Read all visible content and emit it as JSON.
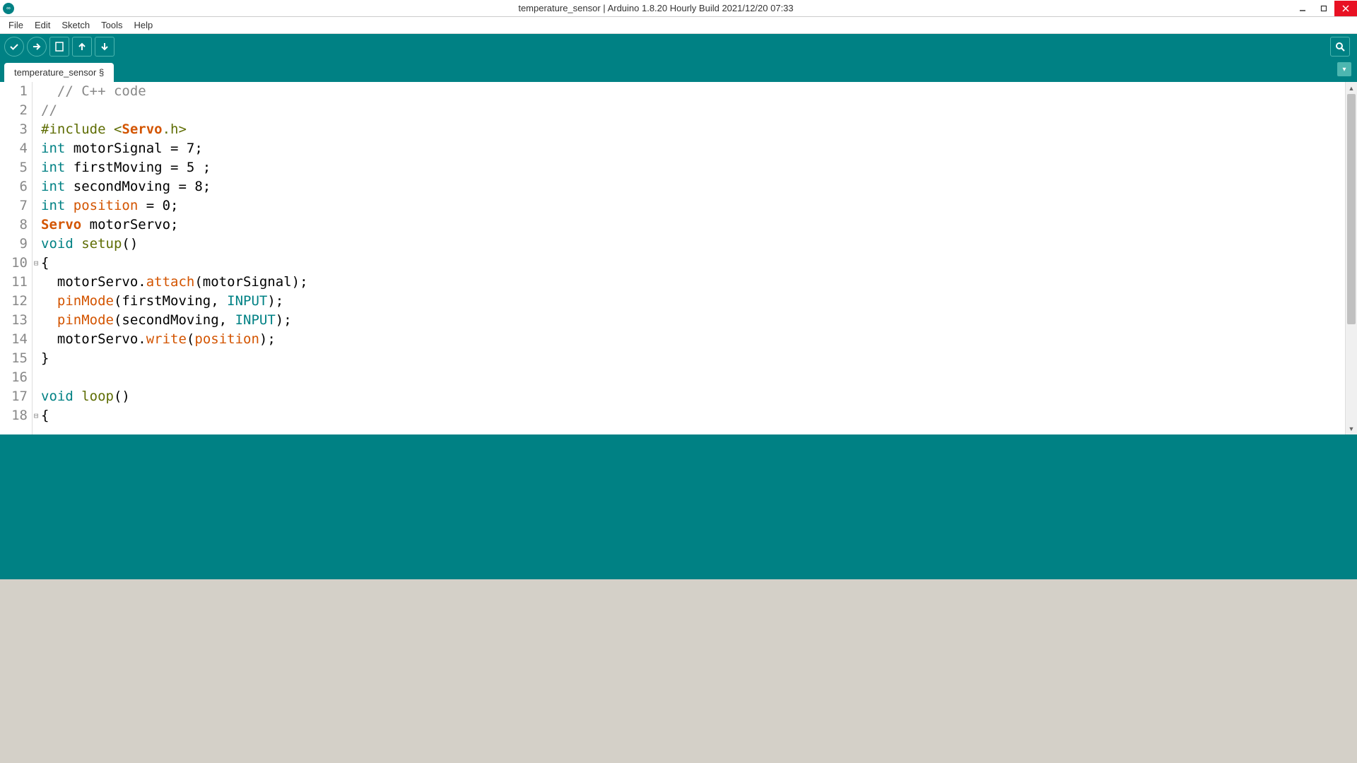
{
  "window": {
    "title": "temperature_sensor | Arduino 1.8.20 Hourly Build 2021/12/20 07:33"
  },
  "menu": {
    "file": "File",
    "edit": "Edit",
    "sketch": "Sketch",
    "tools": "Tools",
    "help": "Help"
  },
  "toolbar_icons": {
    "verify": "verify-icon",
    "upload": "upload-icon",
    "new": "new-icon",
    "open": "open-icon",
    "save": "save-icon",
    "serial": "serial-monitor-icon"
  },
  "tab": {
    "name": "temperature_sensor §"
  },
  "code": {
    "lines": [
      {
        "n": "1",
        "fold": "",
        "tokens": [
          {
            "c": "tk-comment",
            "t": "  // C++ code"
          }
        ]
      },
      {
        "n": "2",
        "fold": "",
        "tokens": [
          {
            "c": "tk-comment",
            "t": "//"
          }
        ]
      },
      {
        "n": "3",
        "fold": "",
        "tokens": [
          {
            "c": "tk-preproc",
            "t": "#include <"
          },
          {
            "c": "tk-keyword",
            "t": "Servo"
          },
          {
            "c": "tk-preproc",
            "t": ".h>"
          }
        ]
      },
      {
        "n": "4",
        "fold": "",
        "tokens": [
          {
            "c": "tk-type",
            "t": "int"
          },
          {
            "c": "",
            "t": " motorSignal = 7;"
          }
        ]
      },
      {
        "n": "5",
        "fold": "",
        "tokens": [
          {
            "c": "tk-type",
            "t": "int"
          },
          {
            "c": "",
            "t": " firstMoving = 5 ;"
          }
        ]
      },
      {
        "n": "6",
        "fold": "",
        "tokens": [
          {
            "c": "tk-type",
            "t": "int"
          },
          {
            "c": "",
            "t": " secondMoving = 8;"
          }
        ]
      },
      {
        "n": "7",
        "fold": "",
        "tokens": [
          {
            "c": "tk-type",
            "t": "int"
          },
          {
            "c": "",
            "t": " "
          },
          {
            "c": "tk-var",
            "t": "position"
          },
          {
            "c": "",
            "t": " = 0;"
          }
        ]
      },
      {
        "n": "8",
        "fold": "",
        "tokens": [
          {
            "c": "tk-keyword",
            "t": "Servo"
          },
          {
            "c": "",
            "t": " motorServo;"
          }
        ]
      },
      {
        "n": "9",
        "fold": "",
        "tokens": [
          {
            "c": "tk-type",
            "t": "void"
          },
          {
            "c": "",
            "t": " "
          },
          {
            "c": "tk-preproc",
            "t": "setup"
          },
          {
            "c": "",
            "t": "()"
          }
        ]
      },
      {
        "n": "10",
        "fold": "⊟",
        "tokens": [
          {
            "c": "",
            "t": "{"
          }
        ]
      },
      {
        "n": "11",
        "fold": "",
        "tokens": [
          {
            "c": "",
            "t": "  motorServo."
          },
          {
            "c": "tk-func",
            "t": "attach"
          },
          {
            "c": "",
            "t": "(motorSignal);"
          }
        ]
      },
      {
        "n": "12",
        "fold": "",
        "tokens": [
          {
            "c": "",
            "t": "  "
          },
          {
            "c": "tk-func",
            "t": "pinMode"
          },
          {
            "c": "",
            "t": "(firstMoving, "
          },
          {
            "c": "tk-const",
            "t": "INPUT"
          },
          {
            "c": "",
            "t": ");"
          }
        ]
      },
      {
        "n": "13",
        "fold": "",
        "tokens": [
          {
            "c": "",
            "t": "  "
          },
          {
            "c": "tk-func",
            "t": "pinMode"
          },
          {
            "c": "",
            "t": "(secondMoving, "
          },
          {
            "c": "tk-const",
            "t": "INPUT"
          },
          {
            "c": "",
            "t": ");"
          }
        ]
      },
      {
        "n": "14",
        "fold": "",
        "tokens": [
          {
            "c": "",
            "t": "  motorServo."
          },
          {
            "c": "tk-func",
            "t": "write"
          },
          {
            "c": "",
            "t": "("
          },
          {
            "c": "tk-var",
            "t": "position"
          },
          {
            "c": "",
            "t": ");"
          }
        ]
      },
      {
        "n": "15",
        "fold": "",
        "tokens": [
          {
            "c": "",
            "t": "}"
          }
        ]
      },
      {
        "n": "16",
        "fold": "",
        "tokens": [
          {
            "c": "",
            "t": ""
          }
        ]
      },
      {
        "n": "17",
        "fold": "",
        "tokens": [
          {
            "c": "tk-type",
            "t": "void"
          },
          {
            "c": "",
            "t": " "
          },
          {
            "c": "tk-preproc",
            "t": "loop"
          },
          {
            "c": "",
            "t": "()"
          }
        ]
      },
      {
        "n": "18",
        "fold": "⊟",
        "tokens": [
          {
            "c": "",
            "t": "{"
          }
        ]
      }
    ]
  }
}
